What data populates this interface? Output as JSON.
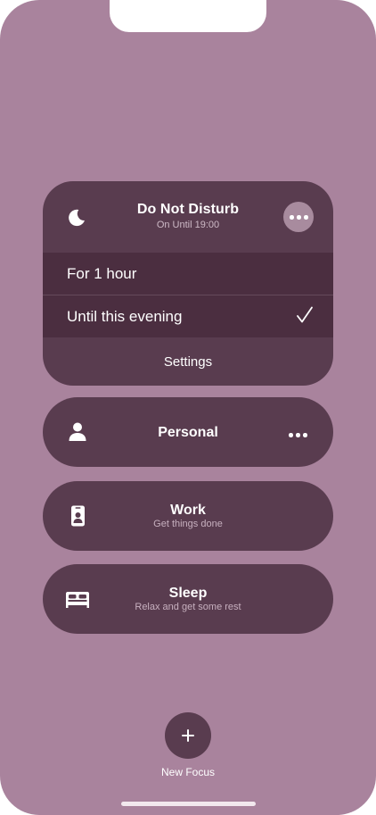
{
  "colors": {
    "background": "#a9839d",
    "card": "#593c4f",
    "selected_option": "#4b2e40",
    "subtitle": "#cdb9c6"
  },
  "dnd": {
    "icon": "moon-icon",
    "title": "Do Not Disturb",
    "subtitle": "On Until 19:00",
    "more_icon": "ellipsis-icon",
    "options": [
      {
        "label": "For 1 hour",
        "selected": false
      },
      {
        "label": "Until this evening",
        "selected": true
      }
    ],
    "settings_label": "Settings"
  },
  "focus_modes": [
    {
      "icon": "person-icon",
      "title": "Personal",
      "subtitle": "",
      "more_icon": "ellipsis-icon"
    },
    {
      "icon": "id-badge-icon",
      "title": "Work",
      "subtitle": "Get things done"
    },
    {
      "icon": "bed-icon",
      "title": "Sleep",
      "subtitle": "Relax and get some rest"
    }
  ],
  "new_focus": {
    "icon": "plus-icon",
    "label": "New Focus"
  }
}
